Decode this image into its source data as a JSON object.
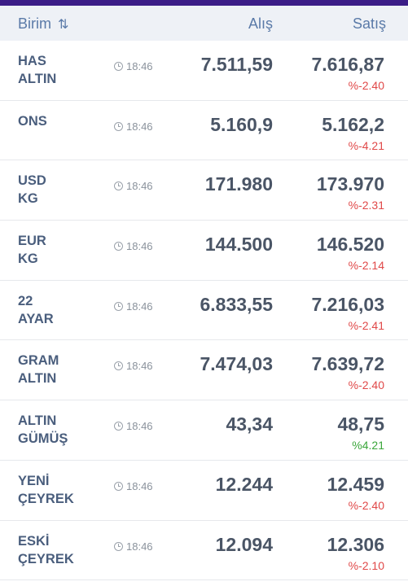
{
  "header": {
    "birim": "Birim",
    "sort_icon": "⇅",
    "alis": "Alış",
    "satis": "Satış"
  },
  "rows": [
    {
      "name": "HAS\nALTIN",
      "time": "18:46",
      "buy": "7.511,59",
      "sell": "7.616,87",
      "change": "%-2.40",
      "trend": "down"
    },
    {
      "name": "ONS",
      "time": "18:46",
      "buy": "5.160,9",
      "sell": "5.162,2",
      "change": "%-4.21",
      "trend": "down"
    },
    {
      "name": "USD\nKG",
      "time": "18:46",
      "buy": "171.980",
      "sell": "173.970",
      "change": "%-2.31",
      "trend": "down"
    },
    {
      "name": "EUR\nKG",
      "time": "18:46",
      "buy": "144.500",
      "sell": "146.520",
      "change": "%-2.14",
      "trend": "down"
    },
    {
      "name": "22\nAYAR",
      "time": "18:46",
      "buy": "6.833,55",
      "sell": "7.216,03",
      "change": "%-2.41",
      "trend": "down"
    },
    {
      "name": "GRAM\nALTIN",
      "time": "18:46",
      "buy": "7.474,03",
      "sell": "7.639,72",
      "change": "%-2.40",
      "trend": "down"
    },
    {
      "name": "ALTIN\nGÜMÜŞ",
      "time": "18:46",
      "buy": "43,34",
      "sell": "48,75",
      "change": "%4.21",
      "trend": "up"
    },
    {
      "name": "YENİ\nÇEYREK",
      "time": "18:46",
      "buy": "12.244",
      "sell": "12.459",
      "change": "%-2.40",
      "trend": "down"
    },
    {
      "name": "ESKİ\nÇEYREK",
      "time": "18:46",
      "buy": "12.094",
      "sell": "12.306",
      "change": "%-2.10",
      "trend": "down"
    }
  ],
  "colors": {
    "accent_bar": "#3b1d87",
    "down": "#e04848",
    "up": "#3aa63a"
  }
}
